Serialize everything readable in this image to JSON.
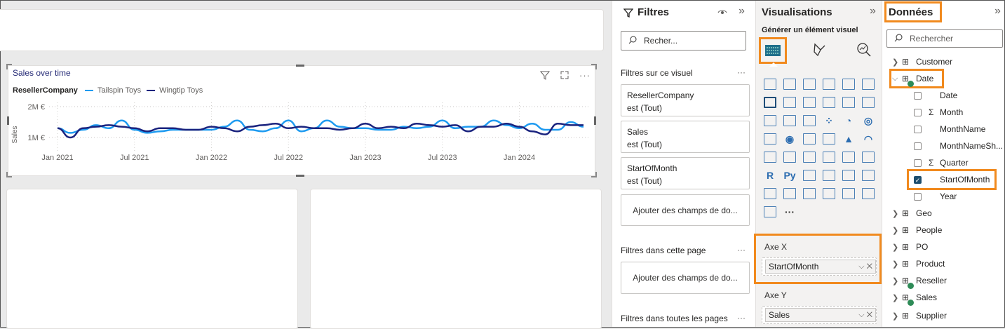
{
  "chart": {
    "title": "Sales over time",
    "legend_title": "ResellerCompany",
    "series": [
      {
        "name": "Tailspin Toys",
        "color": "#1f9bf0"
      },
      {
        "name": "Wingtip Toys",
        "color": "#1a237e"
      }
    ],
    "ylabel": "Sales",
    "yticks": [
      "2M €",
      "1M €"
    ],
    "xticks": [
      "Jan 2021",
      "Jul 2021",
      "Jan 2022",
      "Jul 2022",
      "Jan 2023",
      "Jul 2023",
      "Jan 2024"
    ]
  },
  "chart_data": {
    "type": "line",
    "title": "Sales over time",
    "xlabel": "",
    "ylabel": "Sales",
    "ylim": [
      600000,
      2200000
    ],
    "x": [
      "2021-01",
      "2021-02",
      "2021-03",
      "2021-04",
      "2021-05",
      "2021-06",
      "2021-07",
      "2021-08",
      "2021-09",
      "2021-10",
      "2021-11",
      "2021-12",
      "2022-01",
      "2022-02",
      "2022-03",
      "2022-04",
      "2022-05",
      "2022-06",
      "2022-07",
      "2022-08",
      "2022-09",
      "2022-10",
      "2022-11",
      "2022-12",
      "2023-01",
      "2023-02",
      "2023-03",
      "2023-04",
      "2023-05",
      "2023-06",
      "2023-07",
      "2023-08",
      "2023-09",
      "2023-10",
      "2023-11",
      "2023-12",
      "2024-01",
      "2024-02",
      "2024-03",
      "2024-04",
      "2024-05",
      "2024-06"
    ],
    "series": [
      {
        "name": "Tailspin Toys",
        "values": [
          1300000,
          1150000,
          1250000,
          1400000,
          1300000,
          1550000,
          1250000,
          1150000,
          1200000,
          1250000,
          1250000,
          1250000,
          1250000,
          1350000,
          1550000,
          1250000,
          1200000,
          1300000,
          1550000,
          1200000,
          1300000,
          1550000,
          1350000,
          1300000,
          1300000,
          1250000,
          1250000,
          1350000,
          1300000,
          1350000,
          1550000,
          1300000,
          1350000,
          1350000,
          1550000,
          1400000,
          1300000,
          1450000,
          1250000,
          1250000,
          1500000,
          1350000
        ]
      },
      {
        "name": "Wingtip Toys",
        "values": [
          1300000,
          1000000,
          1300000,
          1350000,
          1400000,
          1350000,
          1300000,
          1200000,
          1300000,
          1300000,
          1250000,
          1250000,
          1350000,
          1300000,
          1200000,
          1350000,
          1400000,
          1450000,
          1300000,
          1350000,
          1300000,
          1300000,
          1250000,
          1300000,
          1450000,
          1300000,
          1350000,
          1300000,
          1450000,
          1400000,
          1350000,
          1400000,
          1200000,
          1350000,
          1350000,
          1450000,
          1350000,
          1200000,
          1100000,
          1450000,
          1400000,
          1400000
        ]
      }
    ]
  },
  "filters": {
    "title": "Filtres",
    "search_placeholder": "Recher...",
    "on_visual": "Filtres sur ce visuel",
    "cards": [
      {
        "field": "ResellerCompany",
        "value": "est (Tout)"
      },
      {
        "field": "Sales",
        "value": "est (Tout)"
      },
      {
        "field": "StartOfMonth",
        "value": "est (Tout)"
      }
    ],
    "add_fields": "Ajouter des champs de do...",
    "on_page": "Filtres dans cette page",
    "add_fields_page": "Ajouter des champs de do...",
    "all_pages": "Filtres dans toutes les pages"
  },
  "viz": {
    "title": "Visualisations",
    "subtitle": "Générer un élément visuel",
    "axis_x_label": "Axe X",
    "axis_x_value": "StartOfMonth",
    "axis_y_label": "Axe Y",
    "axis_y_value": "Sales",
    "more": "···"
  },
  "data_pane": {
    "title": "Données",
    "search_placeholder": "Rechercher",
    "tables": [
      "Customer",
      "Date",
      "Geo",
      "People",
      "PO",
      "Product",
      "Reseller",
      "Sales",
      "Supplier"
    ],
    "date_fields": [
      "Date",
      "Month",
      "MonthName",
      "MonthNameSh...",
      "Quarter",
      "StartOfMonth",
      "Year"
    ]
  }
}
